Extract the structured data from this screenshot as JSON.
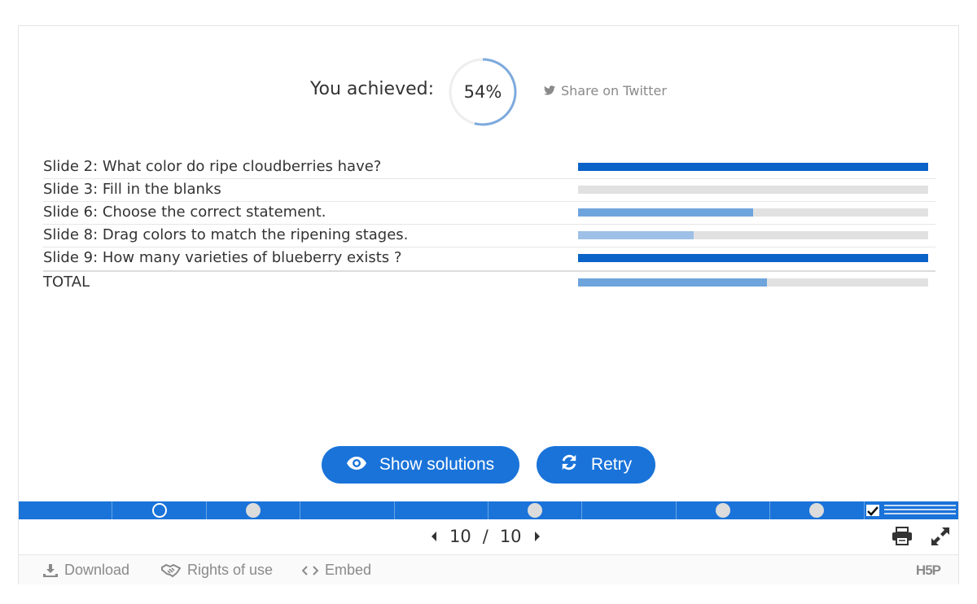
{
  "score": {
    "label": "You achieved:",
    "percent_text": "54%",
    "percent": 54,
    "share_label": "Share on Twitter"
  },
  "results": [
    {
      "label": "Slide 2: What color do ripe cloudberries have?",
      "score": 1.0,
      "color": "#0b63c8"
    },
    {
      "label": "Slide 3: Fill in the blanks",
      "score": 0.0,
      "color": "#6ea4dc"
    },
    {
      "label": "Slide 6: Choose the correct statement.",
      "score": 0.5,
      "color": "#6ea4dc"
    },
    {
      "label": "Slide 8: Drag colors to match the ripening stages.",
      "score": 0.33,
      "color": "#9fc0e6"
    },
    {
      "label": "Slide 9: How many varieties of blueberry exists ?",
      "score": 1.0,
      "color": "#0b63c8"
    }
  ],
  "total": {
    "label": "TOTAL",
    "score": 0.54,
    "color": "#6ea4dc"
  },
  "buttons": {
    "show_solutions": "Show solutions",
    "retry": "Retry"
  },
  "progress": {
    "slides": [
      {
        "state": "none"
      },
      {
        "state": "current"
      },
      {
        "state": "answered"
      },
      {
        "state": "none"
      },
      {
        "state": "none"
      },
      {
        "state": "answered"
      },
      {
        "state": "none"
      },
      {
        "state": "answered"
      },
      {
        "state": "answered"
      },
      {
        "state": "summary"
      }
    ]
  },
  "nav": {
    "current": "10",
    "separator": "/",
    "total": "10"
  },
  "footer": {
    "download": "Download",
    "rights": "Rights of use",
    "embed": "Embed",
    "logo": "H5P"
  },
  "colors": {
    "accent": "#1a73d9",
    "bar_track": "#e1e1e1",
    "muted_text": "#8a8a8a"
  }
}
